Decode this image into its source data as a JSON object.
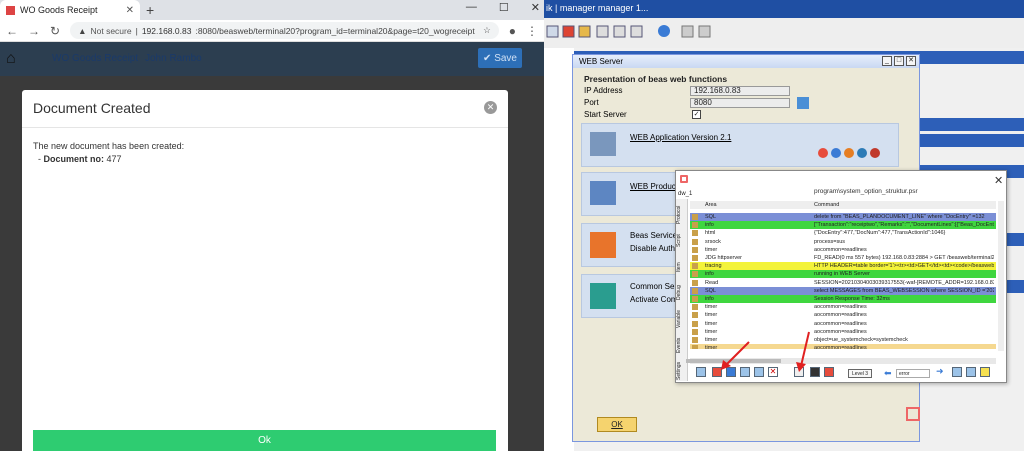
{
  "browser": {
    "tab_title": "WO Goods Receipt",
    "new_tab": "+",
    "not_secure": "Not secure",
    "url_host": "192.168.0.83",
    "url_rest": ":8080/beasweb/terminal20?program_id=terminal20&page=t20_wogreceipt"
  },
  "app": {
    "title": "WO Goods Receipt",
    "user": "John Rambo",
    "save_label": "Save"
  },
  "modal": {
    "title": "Document Created",
    "message": "The new document has been created:",
    "doc_label": "Document no:",
    "doc_no": "477",
    "ok_label": "Ok"
  },
  "sap": {
    "title": "ik | manager manager 1..."
  },
  "webserver": {
    "title": "WEB Server",
    "heading": "Presentation of beas web functions",
    "ip_label": "IP Address",
    "ip_value": "192.168.0.83",
    "port_label": "Port",
    "port_value": "8080",
    "start_label": "Start Server",
    "card1": "WEB Application Version 2.1",
    "card2": "WEB Product",
    "card3a": "Beas Service L",
    "card3b": "Disable Author",
    "card4a": "Common Serv",
    "card4b": "Activate Comm",
    "ok_label": "OK"
  },
  "popup": {
    "dw": "dw_1",
    "path": "program\\system_option_struktur.psr",
    "col_area": "Area",
    "col_command": "Command",
    "side_tabs": [
      "Protocol",
      "Script",
      "Item",
      "Debug",
      "Variable",
      "Events",
      "Settings"
    ],
    "rows": [
      {
        "area": "SQL",
        "cmd": "delete from \"BEAS_PLANDOCUMENT_LINE\" where \"DocEntry\" =132",
        "bg": "#7b8fd6"
      },
      {
        "area": "info",
        "cmd": "[\"Transaction\":\"receiptwo\",\"Remarks\":\"\",\"DocumentLines\":[{\"Beas_DocEntry",
        "bg": "#3fd63f"
      },
      {
        "area": "html",
        "cmd": "{\"DocEntry\":477,\"DocNum\":477,\"TransActionId\":1046}",
        "bg": "#ffffff"
      },
      {
        "area": "srsock",
        "cmd": "process=sus",
        "bg": "#ffffff"
      },
      {
        "area": "timer",
        "cmd": "aocommon=readlines",
        "bg": "#ffffff"
      },
      {
        "area": "JDG httpserver",
        "cmd": "FD_READ(0 ms 557 bytes) 192.168.0.83:2884 > GET /beasweb/terminal2",
        "bg": "#ffffff"
      },
      {
        "area": "tracing",
        "cmd": "HTTP HEADER=table border='1'><tr><td>GET</td><td><code>/beasweb/te",
        "bg": "#f3f33a"
      },
      {
        "area": "info",
        "cmd": "running in WEB Server",
        "bg": "#3fd63f"
      },
      {
        "area": "Read",
        "cmd": "SESSION=20210304003039317553(-waf-[REMOTE_ADDR=192.168.0.83]",
        "bg": "#ffffff"
      },
      {
        "area": "SQL",
        "cmd": "select MESSAGES from BEAS_WEBSESSION where SESSION_ID ='2021",
        "bg": "#7b8fd6"
      },
      {
        "area": "info",
        "cmd": "Session Response Time: 32ms",
        "bg": "#3fd63f"
      },
      {
        "area": "timer",
        "cmd": "aocommon=readlines",
        "bg": "#ffffff"
      },
      {
        "area": "timer",
        "cmd": "aocommon=readlines",
        "bg": "#ffffff"
      },
      {
        "area": "timer",
        "cmd": "aocommon=readlines",
        "bg": "#ffffff"
      },
      {
        "area": "timer",
        "cmd": "aocommon=readlines",
        "bg": "#ffffff"
      },
      {
        "area": "timer",
        "cmd": "object=ue_systemcheck=systemcheck",
        "bg": "#ffffff"
      },
      {
        "area": "timer",
        "cmd": "aocommon=readlines",
        "bg": "#f5d890"
      }
    ],
    "level": "Level 3",
    "error_field": "error"
  }
}
